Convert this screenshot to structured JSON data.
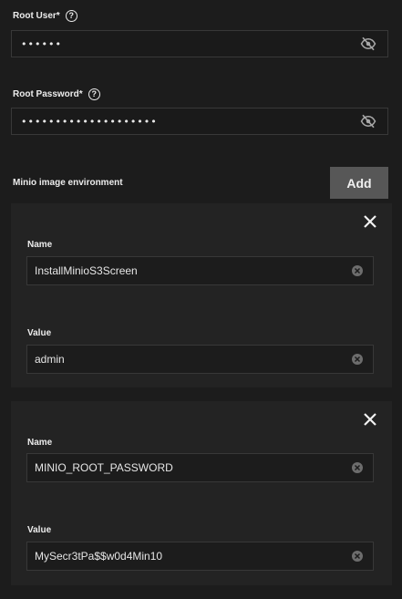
{
  "root_user": {
    "label": "Root User",
    "required_mark": "*",
    "help_icon": "help-circle-icon",
    "value_masked": "••••••",
    "visibility_icon": "eye-off-icon"
  },
  "root_password": {
    "label": "Root Password",
    "required_mark": "*",
    "help_icon": "help-circle-icon",
    "value_masked": "••••••••••••••••••••",
    "visibility_icon": "eye-off-icon"
  },
  "env_section": {
    "title": "Minio image environment",
    "add_label": "Add",
    "entries": [
      {
        "name_label": "Name",
        "name_value": "InstallMinioS3Screen",
        "value_label": "Value",
        "value_value": "admin"
      },
      {
        "name_label": "Name",
        "name_value": "MINIO_ROOT_PASSWORD",
        "value_label": "Value",
        "value_value": "MySecr3tPa$$w0d4Min10"
      }
    ]
  },
  "colors": {
    "background": "#1c1c1c",
    "card": "#232323",
    "add_button": "#575757",
    "border": "#383838"
  }
}
